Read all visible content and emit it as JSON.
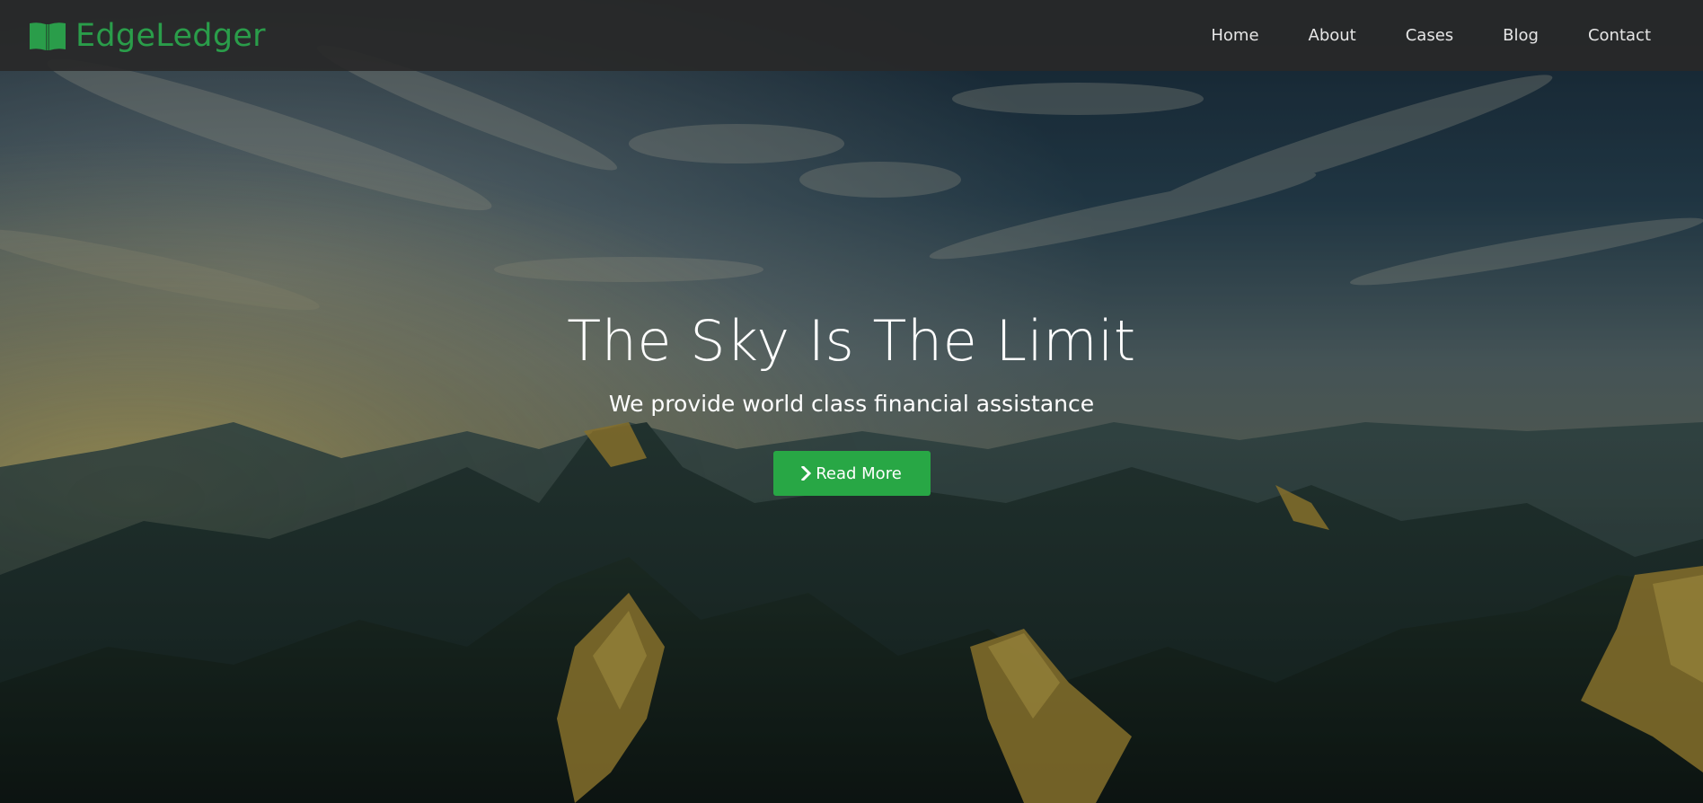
{
  "brand": {
    "name": "EdgeLedger",
    "icon": "book-open-icon",
    "color": "#2a9d4a"
  },
  "nav": {
    "items": [
      {
        "label": "Home"
      },
      {
        "label": "About"
      },
      {
        "label": "Cases"
      },
      {
        "label": "Blog"
      },
      {
        "label": "Contact"
      }
    ]
  },
  "hero": {
    "title": "The Sky Is The Limit",
    "subtitle": "We provide world class financial assistance",
    "cta_label": "Read More",
    "cta_icon": "chevron-right-icon",
    "cta_color": "#28a745",
    "background": "mountain-landscape-image"
  }
}
